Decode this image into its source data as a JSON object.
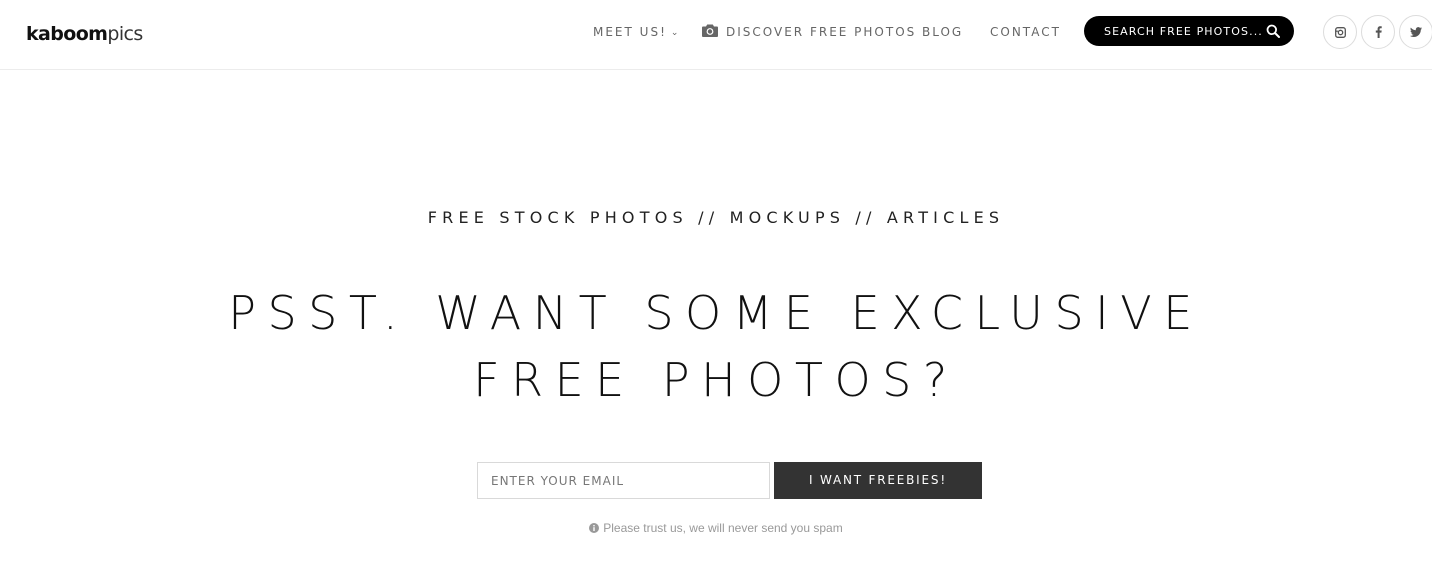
{
  "brand": {
    "logo_bold": "kaboom",
    "logo_light": "pics"
  },
  "nav": {
    "meet_us": "MEET US!",
    "discover": "DISCOVER FREE PHOTOS",
    "blog": "BLOG",
    "contact": "CONTACT"
  },
  "search": {
    "placeholder": "SEARCH FREE PHOTOS..."
  },
  "social": {
    "icons": [
      "instagram-icon",
      "facebook-icon",
      "twitter-icon"
    ]
  },
  "hero": {
    "tagline": "FREE STOCK PHOTOS // MOCKUPS // ARTICLES",
    "headline": "PSST. WANT SOME EXCLUSIVE FREE PHOTOS?"
  },
  "signup": {
    "email_placeholder": "ENTER YOUR EMAIL",
    "button_label": "I WANT FREEBIES!",
    "notice": "Please trust us, we will never send you spam"
  },
  "colors": {
    "accent": "#000000",
    "button": "#333333",
    "muted": "#999999"
  }
}
